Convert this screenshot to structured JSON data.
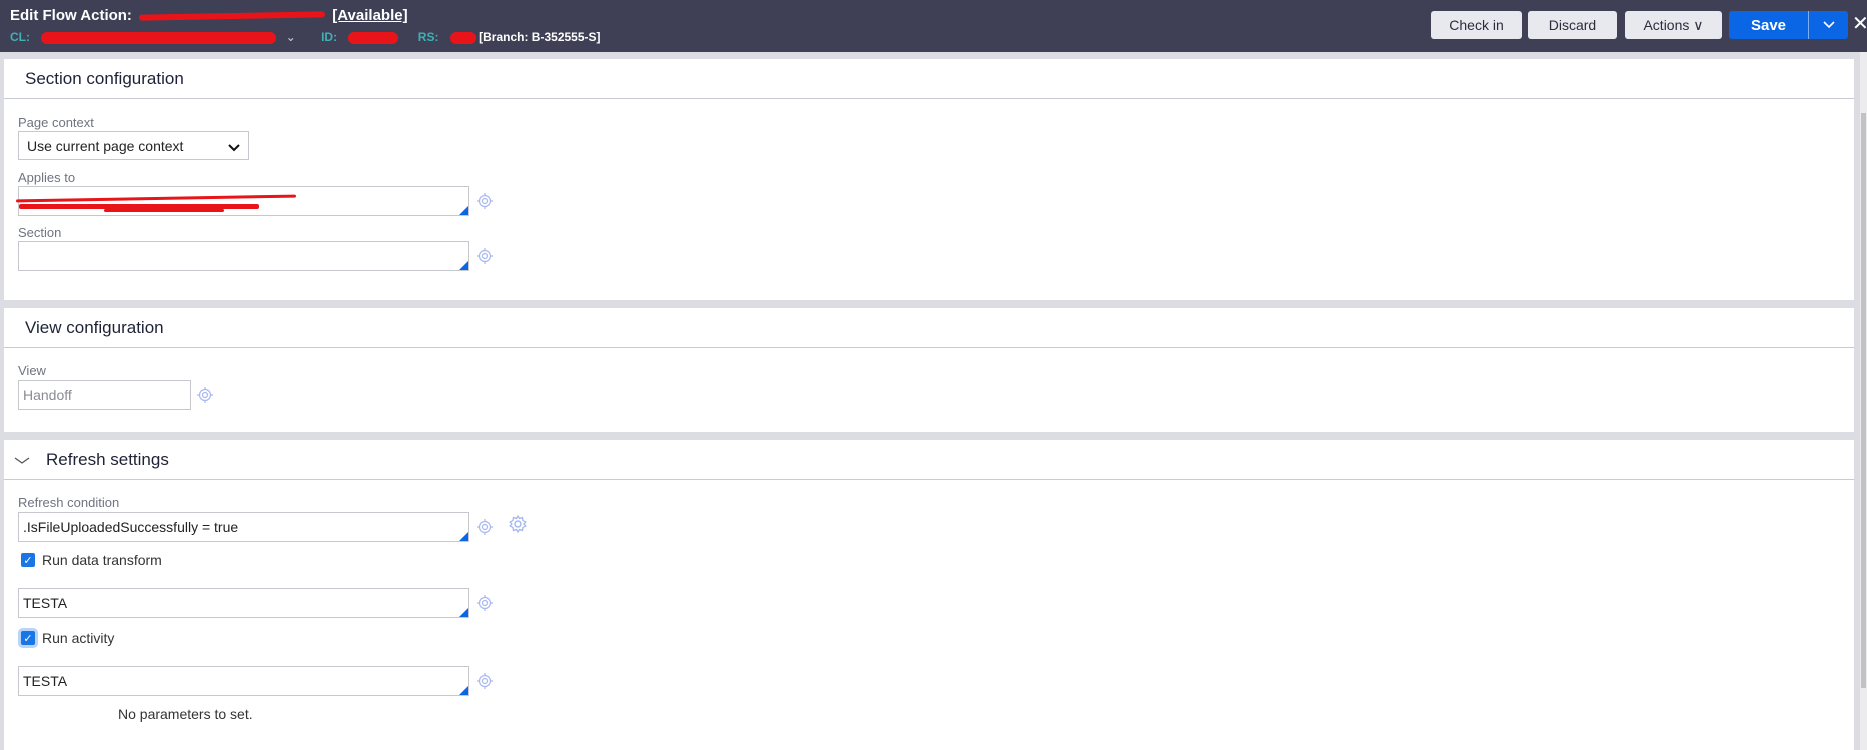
{
  "header": {
    "edit_prefix": "Edit  Flow Action:",
    "status": "[Available]",
    "cl_key": "CL:",
    "id_key": "ID:",
    "rs_key": "RS:",
    "branch": "[Branch: B-352555-S]",
    "buttons": {
      "check_in": "Check in",
      "discard": "Discard",
      "actions": "Actions ∨",
      "save": "Save"
    }
  },
  "section_configuration": {
    "title": "Section configuration",
    "page_context_label": "Page context",
    "page_context_value": "Use current page context",
    "applies_to_label": "Applies to",
    "section_label": "Section",
    "section_value": ""
  },
  "view_configuration": {
    "title": "View configuration",
    "view_label": "View",
    "view_value": "Handoff"
  },
  "refresh_settings": {
    "title": "Refresh settings",
    "refresh_condition_label": "Refresh condition",
    "refresh_condition_value": ".IsFileUploadedSuccessfully = true",
    "run_data_transform_label": "Run data transform",
    "run_data_transform_checked": true,
    "data_transform_value": "TESTA",
    "run_activity_label": "Run activity",
    "run_activity_checked": true,
    "activity_value": "TESTA",
    "no_params_text": "No parameters to set."
  },
  "icons": {
    "target": "crosshair-target-icon",
    "gear": "gear-icon",
    "chevron": "chevron-down-icon",
    "close": "close-icon"
  }
}
